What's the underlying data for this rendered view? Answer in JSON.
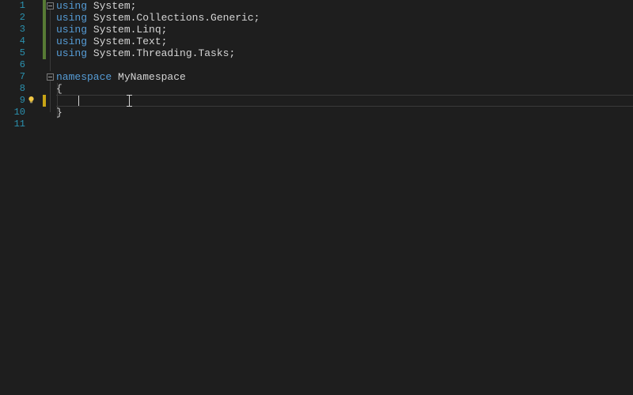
{
  "lineNumbers": [
    "1",
    "2",
    "3",
    "4",
    "5",
    "6",
    "7",
    "8",
    "9",
    "10",
    "11"
  ],
  "code": {
    "l1": {
      "kw": "using",
      "rest": " System;"
    },
    "l2": {
      "kw": "using",
      "rest": " System.Collections.Generic;"
    },
    "l3": {
      "kw": "using",
      "rest": " System.Linq;"
    },
    "l4": {
      "kw": "using",
      "rest": " System.Text;"
    },
    "l5": {
      "kw": "using",
      "rest": " System.Threading.Tasks;"
    },
    "l6": "",
    "l7": {
      "kw": "namespace",
      "rest": " MyNamespace"
    },
    "l8": "{",
    "l9": "",
    "l10": "}",
    "l11": ""
  },
  "icons": {
    "lightbulb": "lightbulb-icon",
    "foldMinus": "fold-minus-icon"
  },
  "colors": {
    "background": "#1e1e1e",
    "keyword": "#569cd6",
    "text": "#d4d4d4",
    "lineNumber": "#2b91af",
    "changeSaved": "#577b35",
    "changeUnsaved": "#c8a415"
  },
  "currentLine": 9
}
